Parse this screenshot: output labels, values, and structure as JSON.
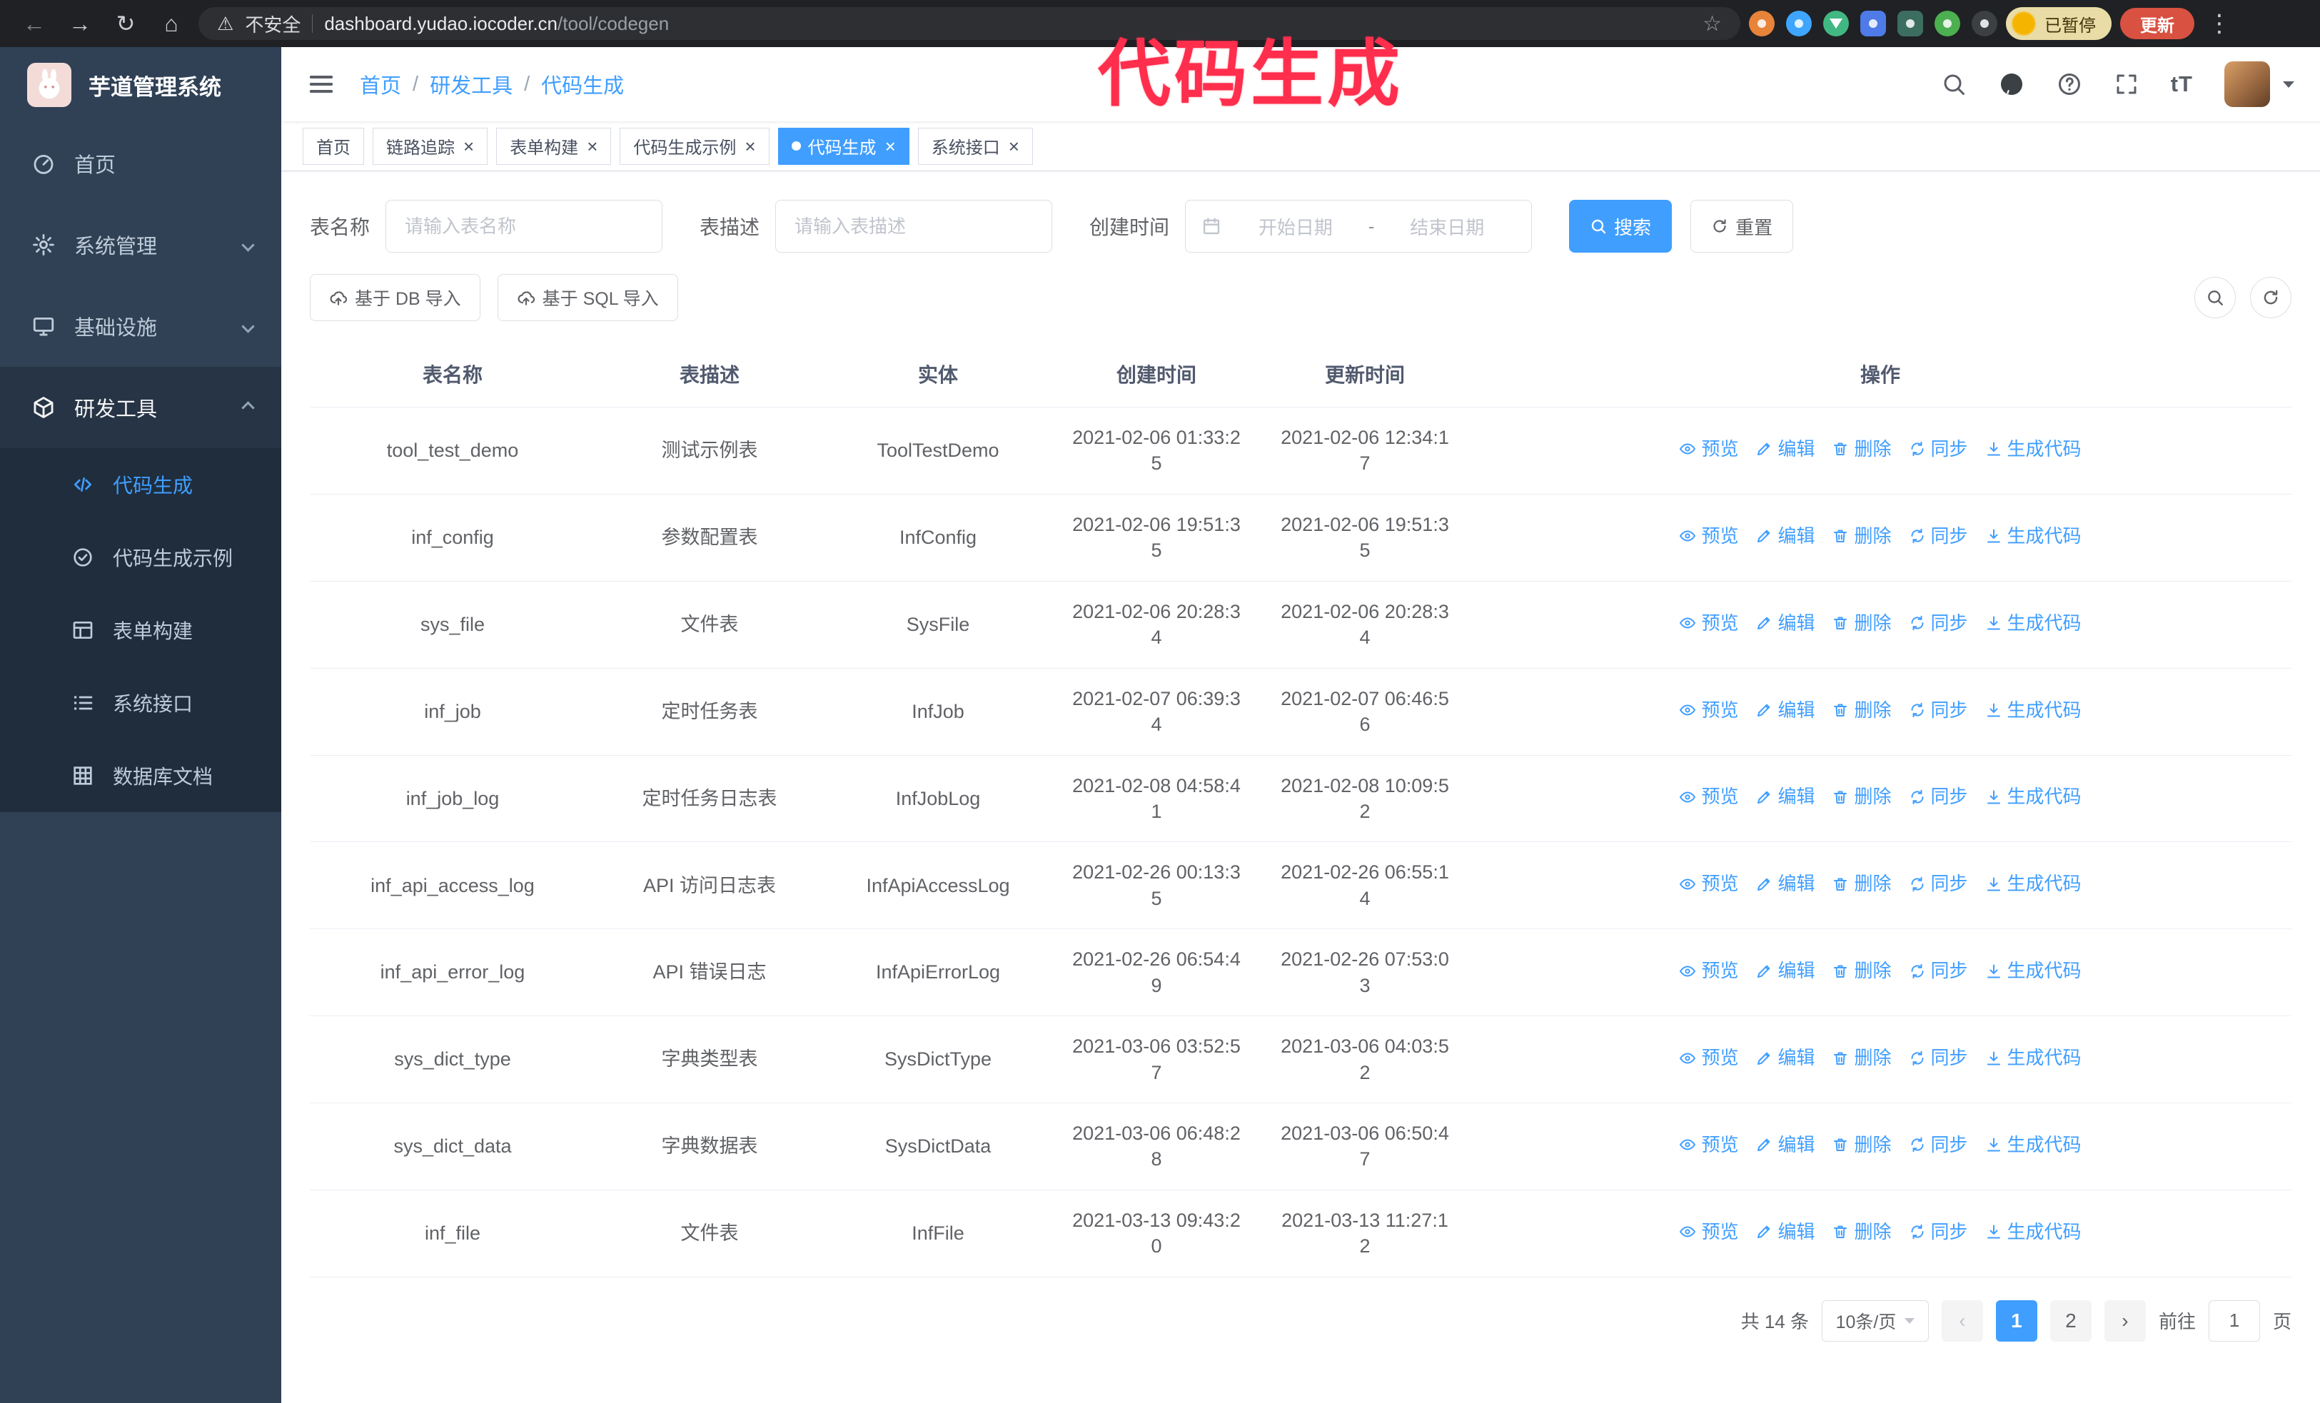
{
  "browser": {
    "security_label": "不安全",
    "url_host": "dashboard.yudao.iocoder.cn",
    "url_path": "/tool/codegen",
    "paused_badge": "已暂停",
    "update_button": "更新"
  },
  "icons": {
    "back": "←",
    "forward": "→",
    "reload": "↻",
    "home": "⌂",
    "warning": "⚠",
    "star": "☆",
    "kebab": "⋮",
    "close": "×",
    "prev": "‹",
    "next": "›",
    "fontsize": "tT"
  },
  "annotation": {
    "text": "代码生成",
    "color": "#ff2e4d"
  },
  "sidebar": {
    "title": "芋道管理系统",
    "items": [
      {
        "label": "首页",
        "icon": "dashboard-icon",
        "expanded": false
      },
      {
        "label": "系统管理",
        "icon": "gear-icon",
        "expanded": false
      },
      {
        "label": "基础设施",
        "icon": "monitor-icon",
        "expanded": false
      },
      {
        "label": "研发工具",
        "icon": "toolbox-icon",
        "expanded": true
      }
    ],
    "sub_items": [
      {
        "label": "代码生成",
        "icon": "code-icon",
        "active": true
      },
      {
        "label": "代码生成示例",
        "icon": "badge-check-icon",
        "active": false
      },
      {
        "label": "表单构建",
        "icon": "form-icon",
        "active": false
      },
      {
        "label": "系统接口",
        "icon": "api-list-icon",
        "active": false
      },
      {
        "label": "数据库文档",
        "icon": "database-grid-icon",
        "active": false
      }
    ]
  },
  "header": {
    "breadcrumb": [
      "首页",
      "研发工具",
      "代码生成"
    ],
    "breadcrumb_separator": "/"
  },
  "tabs": [
    {
      "label": "首页",
      "closable": false,
      "active": false
    },
    {
      "label": "链路追踪",
      "closable": true,
      "active": false
    },
    {
      "label": "表单构建",
      "closable": true,
      "active": false
    },
    {
      "label": "代码生成示例",
      "closable": true,
      "active": false
    },
    {
      "label": "代码生成",
      "closable": true,
      "active": true
    },
    {
      "label": "系统接口",
      "closable": true,
      "active": false
    }
  ],
  "filters": {
    "table_name_label": "表名称",
    "table_name_placeholder": "请输入表名称",
    "table_desc_label": "表描述",
    "table_desc_placeholder": "请输入表描述",
    "create_time_label": "创建时间",
    "date_start_placeholder": "开始日期",
    "date_separator": "-",
    "date_end_placeholder": "结束日期",
    "search_button": "搜索",
    "reset_button": "重置"
  },
  "toolbar": {
    "import_db_button": "基于 DB 导入",
    "import_sql_button": "基于 SQL 导入"
  },
  "table": {
    "columns": [
      "表名称",
      "表描述",
      "实体",
      "创建时间",
      "更新时间",
      "操作"
    ],
    "actions": [
      {
        "id": "preview",
        "label": "预览",
        "icon": "eye-icon"
      },
      {
        "id": "edit",
        "label": "编辑",
        "icon": "edit-icon"
      },
      {
        "id": "delete",
        "label": "删除",
        "icon": "delete-icon"
      },
      {
        "id": "sync",
        "label": "同步",
        "icon": "sync-icon"
      },
      {
        "id": "generate",
        "label": "生成代码",
        "icon": "download-icon"
      }
    ],
    "rows": [
      {
        "name": "tool_test_demo",
        "description": "测试示例表",
        "entity": "ToolTestDemo",
        "created": "2021-02-06 01:33:25",
        "updated": "2021-02-06 12:34:17"
      },
      {
        "name": "inf_config",
        "description": "参数配置表",
        "entity": "InfConfig",
        "created": "2021-02-06 19:51:35",
        "updated": "2021-02-06 19:51:35"
      },
      {
        "name": "sys_file",
        "description": "文件表",
        "entity": "SysFile",
        "created": "2021-02-06 20:28:34",
        "updated": "2021-02-06 20:28:34"
      },
      {
        "name": "inf_job",
        "description": "定时任务表",
        "entity": "InfJob",
        "created": "2021-02-07 06:39:34",
        "updated": "2021-02-07 06:46:56"
      },
      {
        "name": "inf_job_log",
        "description": "定时任务日志表",
        "entity": "InfJobLog",
        "created": "2021-02-08 04:58:41",
        "updated": "2021-02-08 10:09:52"
      },
      {
        "name": "inf_api_access_log",
        "description": "API 访问日志表",
        "entity": "InfApiAccessLog",
        "created": "2021-02-26 00:13:35",
        "updated": "2021-02-26 06:55:14"
      },
      {
        "name": "inf_api_error_log",
        "description": "API 错误日志",
        "entity": "InfApiErrorLog",
        "created": "2021-02-26 06:54:49",
        "updated": "2021-02-26 07:53:03"
      },
      {
        "name": "sys_dict_type",
        "description": "字典类型表",
        "entity": "SysDictType",
        "created": "2021-03-06 03:52:57",
        "updated": "2021-03-06 04:03:52"
      },
      {
        "name": "sys_dict_data",
        "description": "字典数据表",
        "entity": "SysDictData",
        "created": "2021-03-06 06:48:28",
        "updated": "2021-03-06 06:50:47"
      },
      {
        "name": "inf_file",
        "description": "文件表",
        "entity": "InfFile",
        "created": "2021-03-13 09:43:20",
        "updated": "2021-03-13 11:27:12"
      }
    ]
  },
  "pagination": {
    "total_text": "共 14 条",
    "page_size": "10条/页",
    "pages": [
      "1",
      "2"
    ],
    "active_page": "1",
    "goto_label": "前往",
    "goto_value": "1",
    "goto_suffix": "页"
  },
  "colors": {
    "accent": "#409eff",
    "annotation": "#ff2e4d",
    "sidebar_bg": "#304156",
    "submenu_bg": "#1f2d3d",
    "update_button_bg": "#d95140"
  }
}
